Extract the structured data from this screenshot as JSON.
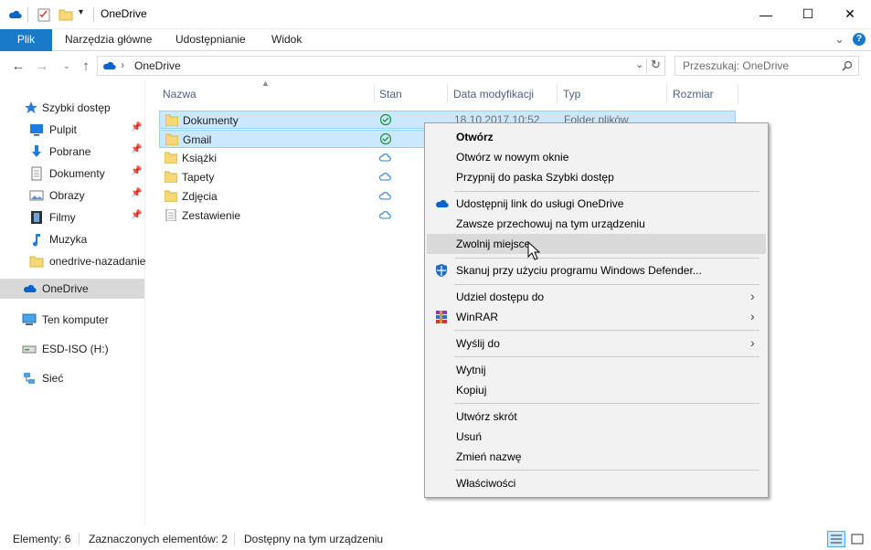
{
  "window": {
    "title": "OneDrive",
    "minimize_glyph": "—",
    "maximize_glyph": "☐",
    "close_glyph": "✕"
  },
  "ribbon": {
    "tabs": [
      "Plik",
      "Narzędzia główne",
      "Udostępnianie",
      "Widok"
    ],
    "expand_glyph": "⌄",
    "help_glyph": "?"
  },
  "address": {
    "location": "OneDrive",
    "search_placeholder": "Przeszukaj: OneDrive"
  },
  "sidebar": {
    "items": [
      {
        "label": "Szybki dostęp",
        "icon": "star-icon",
        "pinned": false
      },
      {
        "label": "Pulpit",
        "icon": "desktop-icon",
        "pinned": true
      },
      {
        "label": "Pobrane",
        "icon": "download-icon",
        "pinned": true
      },
      {
        "label": "Dokumenty",
        "icon": "document-icon",
        "pinned": true
      },
      {
        "label": "Obrazy",
        "icon": "pictures-icon",
        "pinned": true
      },
      {
        "label": "Filmy",
        "icon": "film-icon",
        "pinned": true
      },
      {
        "label": "Muzyka",
        "icon": "music-icon",
        "pinned": false
      },
      {
        "label": "onedrive-nazadanie",
        "icon": "folder-icon",
        "pinned": false
      },
      {
        "label": "OneDrive",
        "icon": "onedrive-icon",
        "pinned": false
      },
      {
        "label": "Ten komputer",
        "icon": "computer-icon",
        "pinned": false
      },
      {
        "label": "ESD-ISO (H:)",
        "icon": "drive-icon",
        "pinned": false
      },
      {
        "label": "Sieć",
        "icon": "network-icon",
        "pinned": false
      }
    ]
  },
  "columns": [
    "Nazwa",
    "Stan",
    "Data modyfikacji",
    "Typ",
    "Rozmiar"
  ],
  "files": [
    {
      "name": "Dokumenty",
      "status": "available-icon",
      "date": "18.10.2017 10:52",
      "type": "Folder plików",
      "selected": true
    },
    {
      "name": "Gmail",
      "status": "available-icon",
      "date": "",
      "type": "",
      "selected": true
    },
    {
      "name": "Książki",
      "status": "cloud-icon",
      "date": "",
      "type": "",
      "selected": false
    },
    {
      "name": "Tapety",
      "status": "cloud-icon",
      "date": "",
      "type": "",
      "selected": false
    },
    {
      "name": "Zdjęcia",
      "status": "cloud-icon",
      "date": "",
      "type": "",
      "selected": false
    },
    {
      "name": "Zestawienie",
      "status": "cloud-icon",
      "date": "",
      "type": "",
      "selected": false
    }
  ],
  "context_menu": {
    "items": [
      {
        "label": "Otwórz",
        "bold": true
      },
      {
        "label": "Otwórz w nowym oknie"
      },
      {
        "label": "Przypnij do paska Szybki dostęp"
      },
      {
        "label": "Udostępnij link do usługi OneDrive",
        "icon": "onedrive-icon"
      },
      {
        "label": "Zawsze przechowuj na tym urządzeniu"
      },
      {
        "label": "Zwolnij miejsce",
        "hover": true
      },
      {
        "label": "Skanuj przy użyciu programu Windows Defender...",
        "icon": "defender-icon"
      },
      {
        "label": "Udziel dostępu do",
        "submenu": true
      },
      {
        "label": "WinRAR",
        "icon": "winrar-icon",
        "submenu": true
      },
      {
        "label": "Wyślij do",
        "submenu": true
      },
      {
        "label": "Wytnij"
      },
      {
        "label": "Kopiuj"
      },
      {
        "label": "Utwórz skrót"
      },
      {
        "label": "Usuń"
      },
      {
        "label": "Zmień nazwę"
      },
      {
        "label": "Właściwości"
      }
    ],
    "arrow_glyph": "›"
  },
  "status": {
    "count": "Elementy: 6",
    "selected": "Zaznaczonych elementów: 2",
    "availability": "Dostępny na tym urządzeniu"
  },
  "colors": {
    "accent": "#1979ca",
    "selection": "#cce8ff",
    "onedrive": "#0a64c8",
    "available": "#1e8e3e",
    "folder": "#f8d775"
  }
}
